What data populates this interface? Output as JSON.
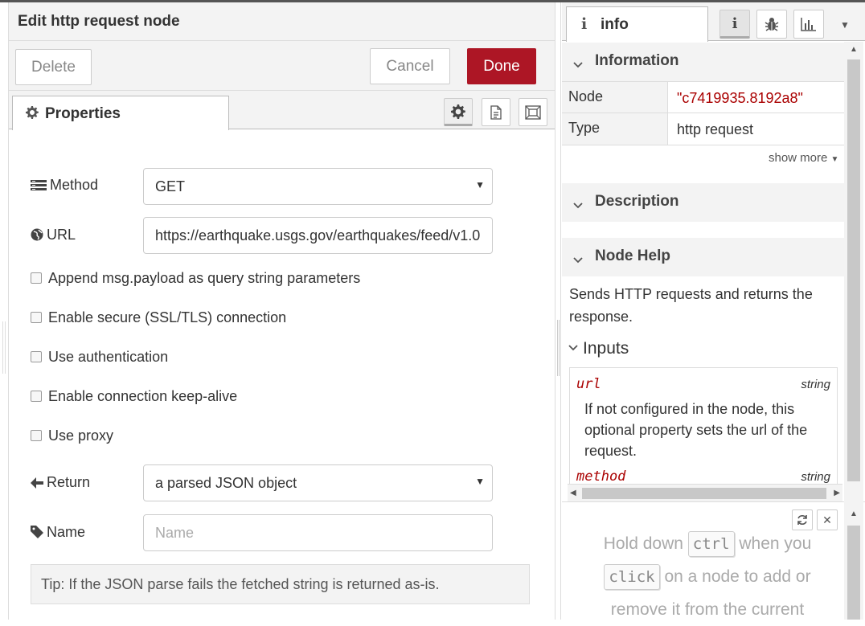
{
  "editor": {
    "title": "Edit http request node",
    "delete_label": "Delete",
    "cancel_label": "Cancel",
    "done_label": "Done",
    "tab_properties": "Properties",
    "icons": [
      "gear-icon",
      "description-icon",
      "appearance-icon"
    ]
  },
  "form": {
    "method_label": "Method",
    "method_value": "GET",
    "url_label": "URL",
    "url_value": "https://earthquake.usgs.gov/earthquakes/feed/v1.0",
    "checkboxes": [
      "Append msg.payload as query string parameters",
      "Enable secure (SSL/TLS) connection",
      "Use authentication",
      "Enable connection keep-alive",
      "Use proxy"
    ],
    "return_label": "Return",
    "return_value": "a parsed JSON object",
    "name_label": "Name",
    "name_placeholder": "Name",
    "tip": "Tip: If the JSON parse fails the fetched string is returned as-is."
  },
  "sidebar": {
    "tab_label": "info",
    "information_title": "Information",
    "rows": [
      {
        "key": "Node",
        "value": "\"c7419935.8192a8\""
      },
      {
        "key": "Type",
        "value": "http request"
      }
    ],
    "show_more": "show more",
    "description_title": "Description",
    "node_help_title": "Node Help",
    "help_text": "Sends HTTP requests and returns the response.",
    "inputs_title": "Inputs",
    "inputs": [
      {
        "name": "url",
        "type": "string",
        "desc": "If not configured in the node, this optional property sets the url of the request."
      },
      {
        "name": "method",
        "type": "string"
      }
    ],
    "hint_pre": "Hold down",
    "hint_key1": "ctrl",
    "hint_mid1": "when you",
    "hint_key2": "click",
    "hint_mid2": "on a node to add or",
    "hint_post": "remove it from the current"
  },
  "colors": {
    "accent": "#ad1625",
    "property_red": "#aa0000"
  }
}
